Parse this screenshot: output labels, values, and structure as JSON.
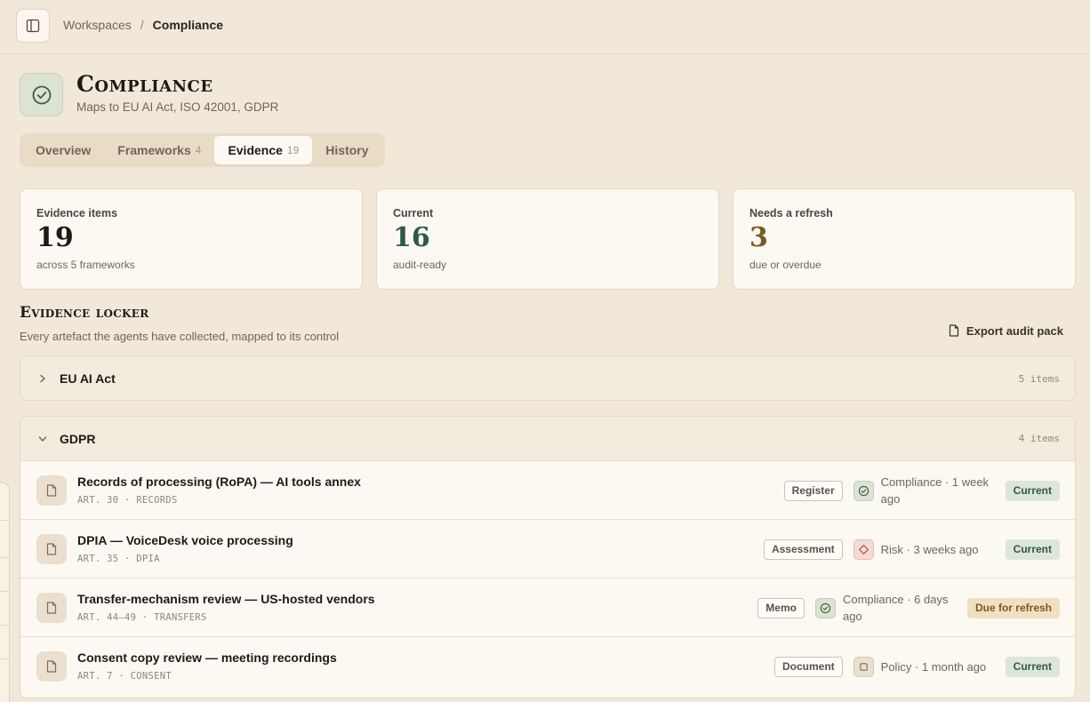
{
  "breadcrumb": {
    "parent": "Workspaces",
    "separator": "/",
    "current": "Compliance"
  },
  "page": {
    "title": "Compliance",
    "subtitle": "Maps to EU AI Act, ISO 42001, GDPR"
  },
  "tabs": [
    {
      "label": "Overview",
      "count": ""
    },
    {
      "label": "Frameworks",
      "count": "4"
    },
    {
      "label": "Evidence",
      "count": "19",
      "active": true
    },
    {
      "label": "History",
      "count": ""
    }
  ],
  "stats": [
    {
      "label": "Evidence items",
      "value": "19",
      "note": "across 5 frameworks",
      "color": "#1c1a17"
    },
    {
      "label": "Current",
      "value": "16",
      "note": "audit-ready",
      "color": "#2f5a45"
    },
    {
      "label": "Needs a refresh",
      "value": "3",
      "note": "due or overdue",
      "color": "#7a5a1f"
    }
  ],
  "locker": {
    "title": "Evidence locker",
    "subtitle": "Every artefact the agents have collected, mapped to its control",
    "export_label": "Export audit pack"
  },
  "groups": [
    {
      "name": "EU AI Act",
      "count": "5 items",
      "expanded": false
    },
    {
      "name": "GDPR",
      "count": "4 items",
      "expanded": true,
      "rows": [
        {
          "title": "Records of processing (RoPA) — AI tools annex",
          "ref": "ART. 30 · RECORDS",
          "type": "Register",
          "agent_icon": "check-circle-icon",
          "agent_meta_1": "Compliance · 1 week",
          "agent_meta_2": "ago",
          "status": "Current"
        },
        {
          "title": "DPIA — VoiceDesk voice processing",
          "ref": "ART. 35 · DPIA",
          "type": "Assessment",
          "agent_icon": "diamond-icon",
          "agent_meta_1": "Risk · 3 weeks ago",
          "agent_meta_2": "",
          "status": "Current"
        },
        {
          "title": "Transfer-mechanism review — US-hosted vendors",
          "ref": "ART. 44–49 · TRANSFERS",
          "type": "Memo",
          "agent_icon": "check-circle-icon",
          "agent_meta_1": "Compliance · 6 days",
          "agent_meta_2": "ago",
          "status": "Due for refresh"
        },
        {
          "title": "Consent copy review — meeting recordings",
          "ref": "ART. 7 · CONSENT",
          "type": "Document",
          "agent_icon": "square-icon",
          "agent_meta_1": "Policy · 1 month ago",
          "agent_meta_2": "",
          "status": "Current"
        }
      ]
    }
  ],
  "colors": {
    "background": "#f1e8d9",
    "card": "#fcf9f3",
    "current": "#2f5a45",
    "refresh": "#7a5a1f",
    "risk": "#b8473a"
  }
}
